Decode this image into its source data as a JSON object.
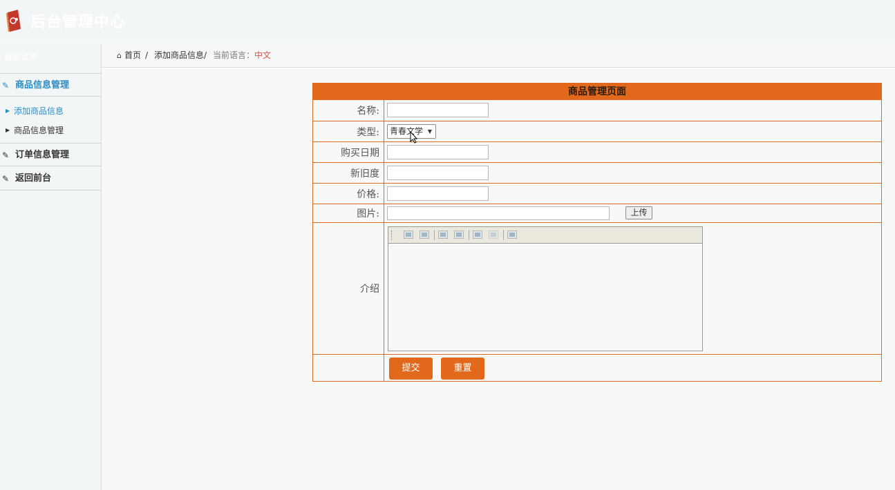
{
  "header": {
    "brand": "后台管理中心",
    "logo_icon": "book-logo-icon"
  },
  "breadcrumb": {
    "home_icon": "home-icon",
    "home": "首页",
    "current": "添加商品信息",
    "lang_label": "当前语言：",
    "lang_value": "中文"
  },
  "sidebar": {
    "search": "搜索菜单",
    "sections": [
      {
        "label": "商品信息管理",
        "icon": "edit-icon",
        "active": true
      },
      {
        "label": "订单信息管理",
        "icon": "edit-icon",
        "active": false
      },
      {
        "label": "返回前台",
        "icon": "edit-icon",
        "active": false
      }
    ],
    "items": [
      {
        "label": "添加商品信息",
        "active": true
      },
      {
        "label": "商品信息管理",
        "active": false
      }
    ]
  },
  "form": {
    "title": "商品管理页面",
    "fields": {
      "name": {
        "label": "名称:",
        "value": ""
      },
      "type": {
        "label": "类型:",
        "value": "青春文学"
      },
      "date": {
        "label": "购买日期",
        "value": ""
      },
      "condition": {
        "label": "新旧度",
        "value": ""
      },
      "price": {
        "label": "价格:",
        "value": ""
      },
      "image": {
        "label": "图片:",
        "value": "",
        "upload": "上传"
      },
      "intro": {
        "label": "介绍",
        "value": ""
      }
    },
    "submit": "提交",
    "reset": "重置"
  },
  "colors": {
    "accent": "#e2691c",
    "link": "#2b8cc4",
    "lang": "#d9534f"
  }
}
